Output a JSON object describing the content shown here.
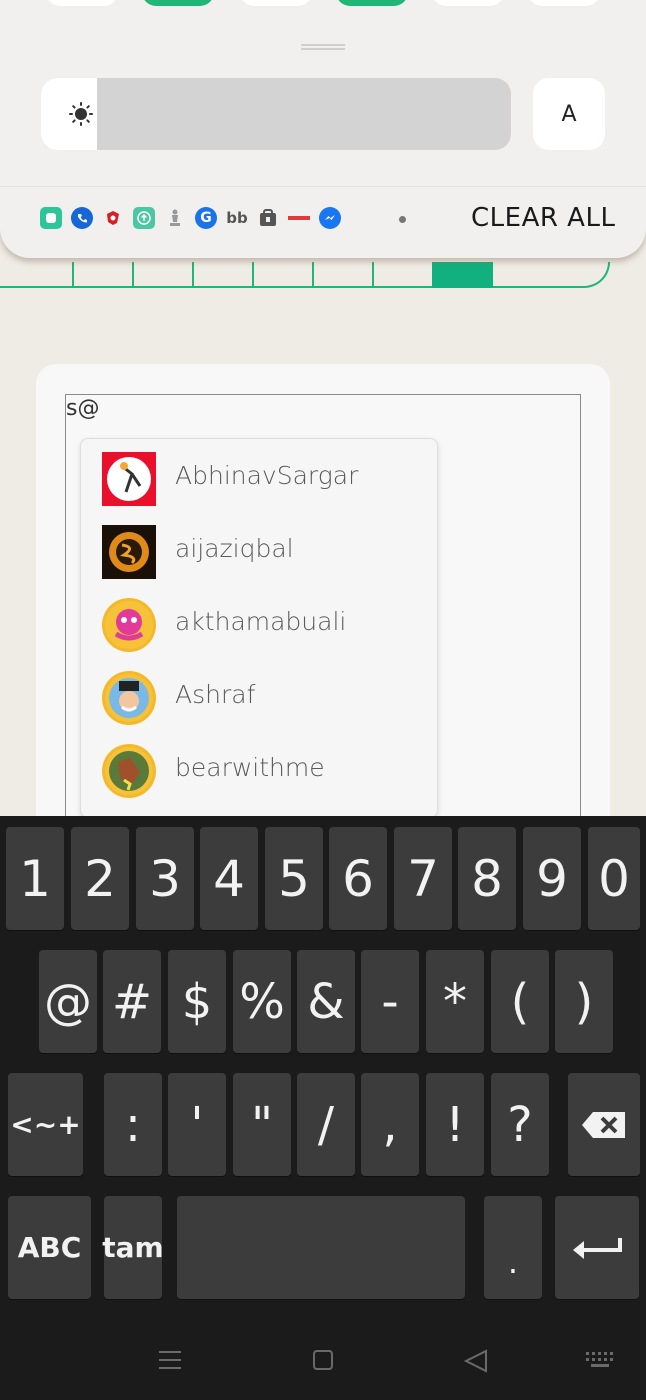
{
  "quick_settings": {
    "auto_brightness_label": "A",
    "brightness_level_percent": 12
  },
  "notifications": {
    "app_icons": [
      "app-icon",
      "phone-icon",
      "lens-icon",
      "upload-icon",
      "chess-icon",
      "google-icon",
      "bb-icon",
      "lock-bag-icon",
      "brand-icon",
      "messenger-icon"
    ],
    "clear_all_label": "CLEAR ALL"
  },
  "composer": {
    "typed_text": "s@",
    "mention_suggestions": [
      {
        "username": "AbhinavSargar"
      },
      {
        "username": "aijaziqbal"
      },
      {
        "username": "akthamabuali"
      },
      {
        "username": "Ashraf"
      },
      {
        "username": "bearwithme"
      }
    ]
  },
  "keyboard": {
    "row1": [
      "1",
      "2",
      "3",
      "4",
      "5",
      "6",
      "7",
      "8",
      "9",
      "0"
    ],
    "row2": [
      "@",
      "#",
      "$",
      "%",
      "&",
      "-",
      "*",
      "(",
      ")"
    ],
    "row3_left": "<~+",
    "row3": [
      ":",
      "'",
      "\"",
      "/",
      ",",
      "!",
      "?"
    ],
    "abc_label": "ABC",
    "lang_label": "tam",
    "period_label": "."
  }
}
